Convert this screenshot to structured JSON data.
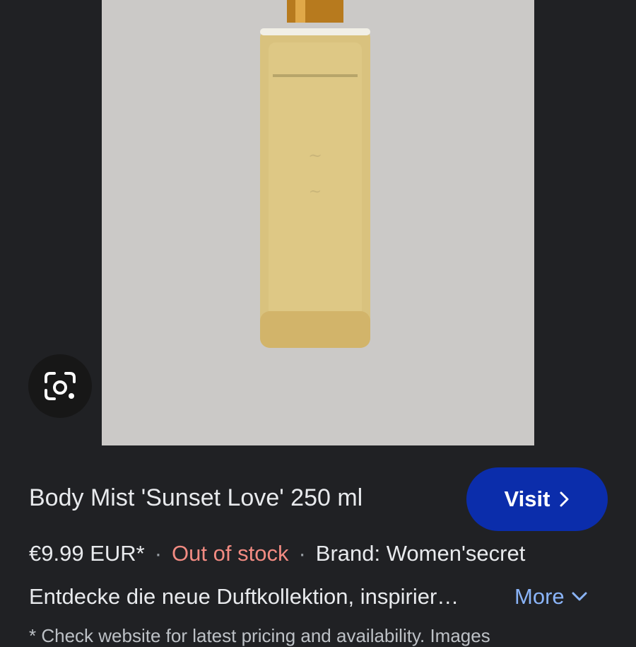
{
  "product": {
    "title": "Body Mist 'Sunset Love' 250 ml",
    "price": "€9.99 EUR*",
    "separator": "·",
    "stock_status": "Out of stock",
    "brand": "Brand: Women'secret",
    "description": "Entdecke die neue Duftkollektion, inspirier…",
    "disclaimer": "* Check website for latest pricing and availability. Images"
  },
  "actions": {
    "visit_label": "Visit",
    "more_label": "More"
  },
  "colors": {
    "visit_button": "#0b2dab",
    "stock_status": "#f28b82",
    "more_link": "#8ab4f8",
    "background": "#202124"
  },
  "icons": {
    "lens": "google-lens-icon",
    "visit_chevron": "chevron-right-icon",
    "more_chevron": "chevron-down-icon"
  }
}
